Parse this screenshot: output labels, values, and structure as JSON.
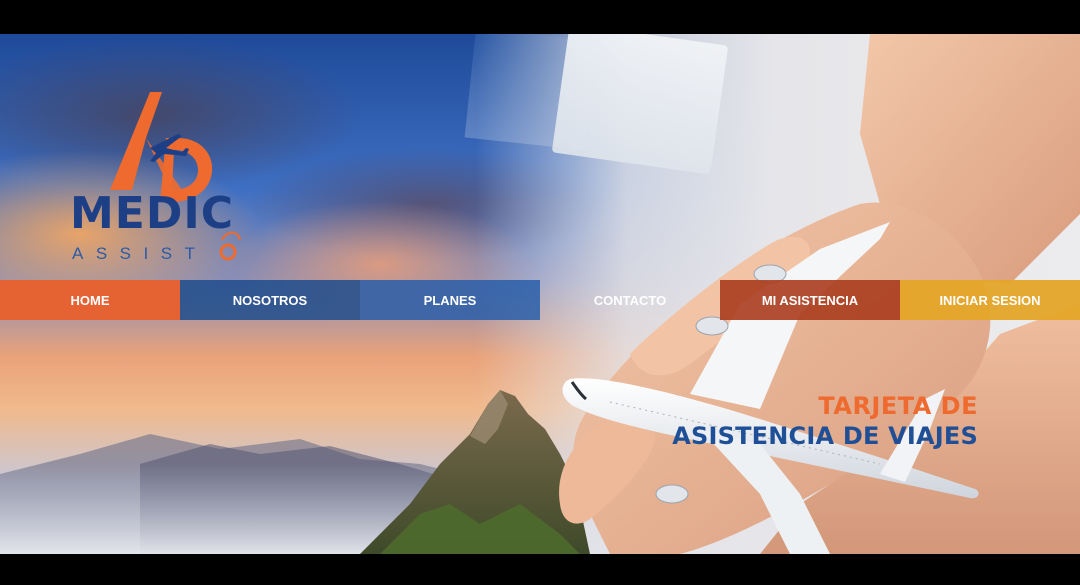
{
  "brand": {
    "name_line1": "MEDIC",
    "name_line2": "ASSIST",
    "primary_color": "#1d3f86",
    "accent_color": "#ee6a2e"
  },
  "nav": {
    "items": [
      {
        "label": "HOME",
        "color": "#e85f2d"
      },
      {
        "label": "NOSOTROS",
        "color": "#1e4c8c"
      },
      {
        "label": "PLANES",
        "color": "#245ca8"
      },
      {
        "label": "CONTACTO",
        "color": "transparent"
      },
      {
        "label": "MI ASISTENCIA",
        "color": "#aa3c1e"
      },
      {
        "label": "INICIAR SESION",
        "color": "#e4a528"
      }
    ]
  },
  "hero": {
    "headline_line1": "TARJETA DE",
    "headline_line2": "ASISTENCIA DE VIAJES",
    "image_icon": "airplane-in-hands-illustration"
  }
}
